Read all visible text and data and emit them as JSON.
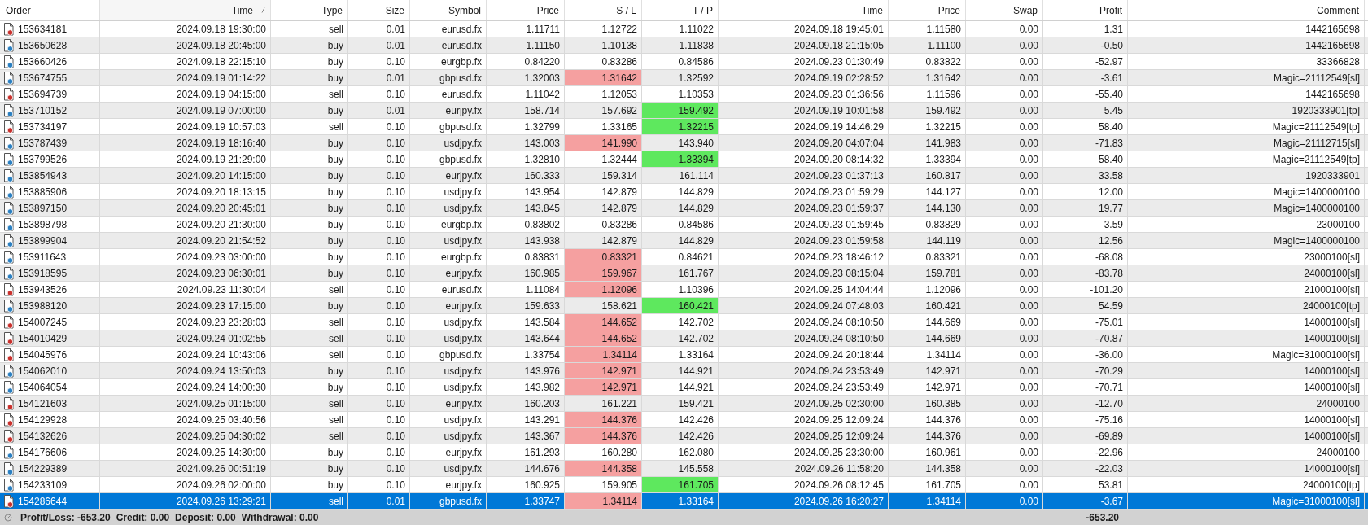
{
  "table": {
    "columns": [
      {
        "label": "Order",
        "sorted": false
      },
      {
        "label": "Time",
        "sorted": true
      },
      {
        "label": "Type",
        "sorted": false
      },
      {
        "label": "Size",
        "sorted": false
      },
      {
        "label": "Symbol",
        "sorted": false
      },
      {
        "label": "Price",
        "sorted": false
      },
      {
        "label": "S / L",
        "sorted": false
      },
      {
        "label": "T / P",
        "sorted": false
      },
      {
        "label": "Time",
        "sorted": false
      },
      {
        "label": "Price",
        "sorted": false
      },
      {
        "label": "Swap",
        "sorted": false
      },
      {
        "label": "Profit",
        "sorted": false
      },
      {
        "label": "Comment",
        "sorted": false
      }
    ],
    "rows": [
      {
        "kind": "sell",
        "selected": false,
        "sl_hit": false,
        "tp_hit": false,
        "cells": [
          "153634181",
          "2024.09.18 19:30:00",
          "sell",
          "0.01",
          "eurusd.fx",
          "1.11711",
          "1.12722",
          "1.11022",
          "2024.09.18 19:45:01",
          "1.11580",
          "0.00",
          "1.31",
          "1442165698"
        ]
      },
      {
        "kind": "buy",
        "selected": false,
        "sl_hit": false,
        "tp_hit": false,
        "cells": [
          "153650628",
          "2024.09.18 20:45:00",
          "buy",
          "0.01",
          "eurusd.fx",
          "1.11150",
          "1.10138",
          "1.11838",
          "2024.09.18 21:15:05",
          "1.11100",
          "0.00",
          "-0.50",
          "1442165698"
        ]
      },
      {
        "kind": "buy",
        "selected": false,
        "sl_hit": false,
        "tp_hit": false,
        "cells": [
          "153660426",
          "2024.09.18 22:15:10",
          "buy",
          "0.10",
          "eurgbp.fx",
          "0.84220",
          "0.83286",
          "0.84586",
          "2024.09.23 01:30:49",
          "0.83822",
          "0.00",
          "-52.97",
          "33366828"
        ]
      },
      {
        "kind": "buy",
        "selected": false,
        "sl_hit": true,
        "tp_hit": false,
        "cells": [
          "153674755",
          "2024.09.19 01:14:22",
          "buy",
          "0.01",
          "gbpusd.fx",
          "1.32003",
          "1.31642",
          "1.32592",
          "2024.09.19 02:28:52",
          "1.31642",
          "0.00",
          "-3.61",
          "Magic=21112549[sl]"
        ]
      },
      {
        "kind": "sell",
        "selected": false,
        "sl_hit": false,
        "tp_hit": false,
        "cells": [
          "153694739",
          "2024.09.19 04:15:00",
          "sell",
          "0.10",
          "eurusd.fx",
          "1.11042",
          "1.12053",
          "1.10353",
          "2024.09.23 01:36:56",
          "1.11596",
          "0.00",
          "-55.40",
          "1442165698"
        ]
      },
      {
        "kind": "buy",
        "selected": false,
        "sl_hit": false,
        "tp_hit": true,
        "cells": [
          "153710152",
          "2024.09.19 07:00:00",
          "buy",
          "0.01",
          "eurjpy.fx",
          "158.714",
          "157.692",
          "159.492",
          "2024.09.19 10:01:58",
          "159.492",
          "0.00",
          "5.45",
          "1920333901[tp]"
        ]
      },
      {
        "kind": "sell",
        "selected": false,
        "sl_hit": false,
        "tp_hit": true,
        "cells": [
          "153734197",
          "2024.09.19 10:57:03",
          "sell",
          "0.10",
          "gbpusd.fx",
          "1.32799",
          "1.33165",
          "1.32215",
          "2024.09.19 14:46:29",
          "1.32215",
          "0.00",
          "58.40",
          "Magic=21112549[tp]"
        ]
      },
      {
        "kind": "buy",
        "selected": false,
        "sl_hit": true,
        "tp_hit": false,
        "cells": [
          "153787439",
          "2024.09.19 18:16:40",
          "buy",
          "0.10",
          "usdjpy.fx",
          "143.003",
          "141.990",
          "143.940",
          "2024.09.20 04:07:04",
          "141.983",
          "0.00",
          "-71.83",
          "Magic=21112715[sl]"
        ]
      },
      {
        "kind": "buy",
        "selected": false,
        "sl_hit": false,
        "tp_hit": true,
        "cells": [
          "153799526",
          "2024.09.19 21:29:00",
          "buy",
          "0.10",
          "gbpusd.fx",
          "1.32810",
          "1.32444",
          "1.33394",
          "2024.09.20 08:14:32",
          "1.33394",
          "0.00",
          "58.40",
          "Magic=21112549[tp]"
        ]
      },
      {
        "kind": "buy",
        "selected": false,
        "sl_hit": false,
        "tp_hit": false,
        "cells": [
          "153854943",
          "2024.09.20 14:15:00",
          "buy",
          "0.10",
          "eurjpy.fx",
          "160.333",
          "159.314",
          "161.114",
          "2024.09.23 01:37:13",
          "160.817",
          "0.00",
          "33.58",
          "1920333901"
        ]
      },
      {
        "kind": "buy",
        "selected": false,
        "sl_hit": false,
        "tp_hit": false,
        "cells": [
          "153885906",
          "2024.09.20 18:13:15",
          "buy",
          "0.10",
          "usdjpy.fx",
          "143.954",
          "142.879",
          "144.829",
          "2024.09.23 01:59:29",
          "144.127",
          "0.00",
          "12.00",
          "Magic=1400000100"
        ]
      },
      {
        "kind": "buy",
        "selected": false,
        "sl_hit": false,
        "tp_hit": false,
        "cells": [
          "153897150",
          "2024.09.20 20:45:01",
          "buy",
          "0.10",
          "usdjpy.fx",
          "143.845",
          "142.879",
          "144.829",
          "2024.09.23 01:59:37",
          "144.130",
          "0.00",
          "19.77",
          "Magic=1400000100"
        ]
      },
      {
        "kind": "buy",
        "selected": false,
        "sl_hit": false,
        "tp_hit": false,
        "cells": [
          "153898798",
          "2024.09.20 21:30:00",
          "buy",
          "0.10",
          "eurgbp.fx",
          "0.83802",
          "0.83286",
          "0.84586",
          "2024.09.23 01:59:45",
          "0.83829",
          "0.00",
          "3.59",
          "23000100"
        ]
      },
      {
        "kind": "buy",
        "selected": false,
        "sl_hit": false,
        "tp_hit": false,
        "cells": [
          "153899904",
          "2024.09.20 21:54:52",
          "buy",
          "0.10",
          "usdjpy.fx",
          "143.938",
          "142.879",
          "144.829",
          "2024.09.23 01:59:58",
          "144.119",
          "0.00",
          "12.56",
          "Magic=1400000100"
        ]
      },
      {
        "kind": "buy",
        "selected": false,
        "sl_hit": true,
        "tp_hit": false,
        "cells": [
          "153911643",
          "2024.09.23 03:00:00",
          "buy",
          "0.10",
          "eurgbp.fx",
          "0.83831",
          "0.83321",
          "0.84621",
          "2024.09.23 18:46:12",
          "0.83321",
          "0.00",
          "-68.08",
          "23000100[sl]"
        ]
      },
      {
        "kind": "buy",
        "selected": false,
        "sl_hit": true,
        "tp_hit": false,
        "cells": [
          "153918595",
          "2024.09.23 06:30:01",
          "buy",
          "0.10",
          "eurjpy.fx",
          "160.985",
          "159.967",
          "161.767",
          "2024.09.23 08:15:04",
          "159.781",
          "0.00",
          "-83.78",
          "24000100[sl]"
        ]
      },
      {
        "kind": "sell",
        "selected": false,
        "sl_hit": true,
        "tp_hit": false,
        "cells": [
          "153943526",
          "2024.09.23 11:30:04",
          "sell",
          "0.10",
          "eurusd.fx",
          "1.11084",
          "1.12096",
          "1.10396",
          "2024.09.25 14:04:44",
          "1.12096",
          "0.00",
          "-101.20",
          "21000100[sl]"
        ]
      },
      {
        "kind": "buy",
        "selected": false,
        "sl_hit": false,
        "tp_hit": true,
        "cells": [
          "153988120",
          "2024.09.23 17:15:00",
          "buy",
          "0.10",
          "eurjpy.fx",
          "159.633",
          "158.621",
          "160.421",
          "2024.09.24 07:48:03",
          "160.421",
          "0.00",
          "54.59",
          "24000100[tp]"
        ]
      },
      {
        "kind": "sell",
        "selected": false,
        "sl_hit": true,
        "tp_hit": false,
        "cells": [
          "154007245",
          "2024.09.23 23:28:03",
          "sell",
          "0.10",
          "usdjpy.fx",
          "143.584",
          "144.652",
          "142.702",
          "2024.09.24 08:10:50",
          "144.669",
          "0.00",
          "-75.01",
          "14000100[sl]"
        ]
      },
      {
        "kind": "sell",
        "selected": false,
        "sl_hit": true,
        "tp_hit": false,
        "cells": [
          "154010429",
          "2024.09.24 01:02:55",
          "sell",
          "0.10",
          "usdjpy.fx",
          "143.644",
          "144.652",
          "142.702",
          "2024.09.24 08:10:50",
          "144.669",
          "0.00",
          "-70.87",
          "14000100[sl]"
        ]
      },
      {
        "kind": "sell",
        "selected": false,
        "sl_hit": true,
        "tp_hit": false,
        "cells": [
          "154045976",
          "2024.09.24 10:43:06",
          "sell",
          "0.10",
          "gbpusd.fx",
          "1.33754",
          "1.34114",
          "1.33164",
          "2024.09.24 20:18:44",
          "1.34114",
          "0.00",
          "-36.00",
          "Magic=31000100[sl]"
        ]
      },
      {
        "kind": "buy",
        "selected": false,
        "sl_hit": true,
        "tp_hit": false,
        "cells": [
          "154062010",
          "2024.09.24 13:50:03",
          "buy",
          "0.10",
          "usdjpy.fx",
          "143.976",
          "142.971",
          "144.921",
          "2024.09.24 23:53:49",
          "142.971",
          "0.00",
          "-70.29",
          "14000100[sl]"
        ]
      },
      {
        "kind": "buy",
        "selected": false,
        "sl_hit": true,
        "tp_hit": false,
        "cells": [
          "154064054",
          "2024.09.24 14:00:30",
          "buy",
          "0.10",
          "usdjpy.fx",
          "143.982",
          "142.971",
          "144.921",
          "2024.09.24 23:53:49",
          "142.971",
          "0.00",
          "-70.71",
          "14000100[sl]"
        ]
      },
      {
        "kind": "sell",
        "selected": false,
        "sl_hit": false,
        "tp_hit": false,
        "cells": [
          "154121603",
          "2024.09.25 01:15:00",
          "sell",
          "0.10",
          "eurjpy.fx",
          "160.203",
          "161.221",
          "159.421",
          "2024.09.25 02:30:00",
          "160.385",
          "0.00",
          "-12.70",
          "24000100"
        ]
      },
      {
        "kind": "sell",
        "selected": false,
        "sl_hit": true,
        "tp_hit": false,
        "cells": [
          "154129928",
          "2024.09.25 03:40:56",
          "sell",
          "0.10",
          "usdjpy.fx",
          "143.291",
          "144.376",
          "142.426",
          "2024.09.25 12:09:24",
          "144.376",
          "0.00",
          "-75.16",
          "14000100[sl]"
        ]
      },
      {
        "kind": "sell",
        "selected": false,
        "sl_hit": true,
        "tp_hit": false,
        "cells": [
          "154132626",
          "2024.09.25 04:30:02",
          "sell",
          "0.10",
          "usdjpy.fx",
          "143.367",
          "144.376",
          "142.426",
          "2024.09.25 12:09:24",
          "144.376",
          "0.00",
          "-69.89",
          "14000100[sl]"
        ]
      },
      {
        "kind": "buy",
        "selected": false,
        "sl_hit": false,
        "tp_hit": false,
        "cells": [
          "154176606",
          "2024.09.25 14:30:00",
          "buy",
          "0.10",
          "eurjpy.fx",
          "161.293",
          "160.280",
          "162.080",
          "2024.09.25 23:30:00",
          "160.961",
          "0.00",
          "-22.96",
          "24000100"
        ]
      },
      {
        "kind": "buy",
        "selected": false,
        "sl_hit": true,
        "tp_hit": false,
        "cells": [
          "154229389",
          "2024.09.26 00:51:19",
          "buy",
          "0.10",
          "usdjpy.fx",
          "144.676",
          "144.358",
          "145.558",
          "2024.09.26 11:58:20",
          "144.358",
          "0.00",
          "-22.03",
          "14000100[sl]"
        ]
      },
      {
        "kind": "buy",
        "selected": false,
        "sl_hit": false,
        "tp_hit": true,
        "cells": [
          "154233109",
          "2024.09.26 02:00:00",
          "buy",
          "0.10",
          "eurjpy.fx",
          "160.925",
          "159.905",
          "161.705",
          "2024.09.26 08:12:45",
          "161.705",
          "0.00",
          "53.81",
          "24000100[tp]"
        ]
      },
      {
        "kind": "sell",
        "selected": true,
        "sl_hit": true,
        "tp_hit": false,
        "cells": [
          "154286644",
          "2024.09.26 13:29:21",
          "sell",
          "0.01",
          "gbpusd.fx",
          "1.33747",
          "1.34114",
          "1.33164",
          "2024.09.26 16:20:27",
          "1.34114",
          "0.00",
          "-3.67",
          "Magic=31000100[sl]"
        ]
      }
    ]
  },
  "status_bar": {
    "items": [
      "Profit/Loss: -653.20",
      "Credit: 0.00",
      "Deposit: 0.00",
      "Withdrawal: 0.00"
    ],
    "total": "-653.20"
  }
}
